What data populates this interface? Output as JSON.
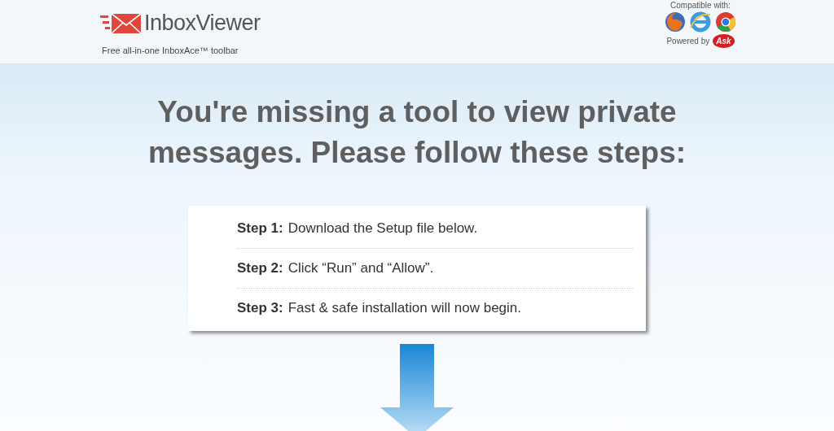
{
  "header": {
    "brand": "InboxViewer",
    "tagline": "Free all-in-one InboxAce™ toolbar",
    "compatible_label": "Compatible with:",
    "powered_label": "Powered by",
    "powered_logo": "Ask"
  },
  "headline": "You're missing a tool to view private messages. Please follow these steps:",
  "steps": [
    {
      "label": "Step 1:",
      "text": "Download the Setup file below."
    },
    {
      "label": "Step 2:",
      "text": "Click “Run” and “Allow”."
    },
    {
      "label": "Step 3:",
      "text": "Fast & safe installation will now begin."
    }
  ]
}
